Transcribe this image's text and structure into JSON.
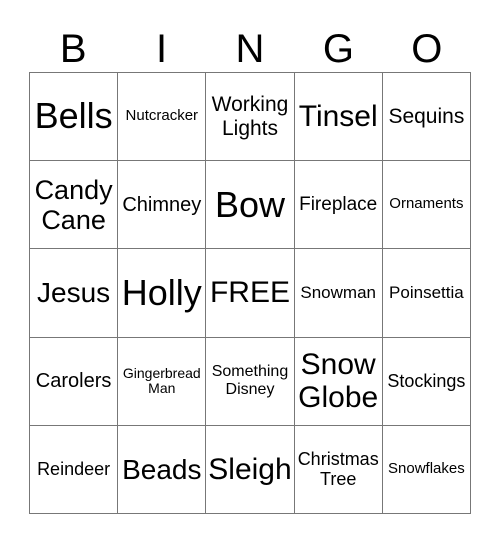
{
  "header": [
    "B",
    "I",
    "N",
    "G",
    "O"
  ],
  "cells": [
    "Bells",
    "Nutcracker",
    "Working Lights",
    "Tinsel",
    "Sequins",
    "Candy Cane",
    "Chimney",
    "Bow",
    "Fireplace",
    "Ornaments",
    "Jesus",
    "Holly",
    "FREE",
    "Snowman",
    "Poinsettia",
    "Carolers",
    "Gingerbread Man",
    "Something Disney",
    "Snow Globe",
    "Stockings",
    "Reindeer",
    "Beads",
    "Sleigh",
    "Christmas Tree",
    "Snowflakes"
  ]
}
